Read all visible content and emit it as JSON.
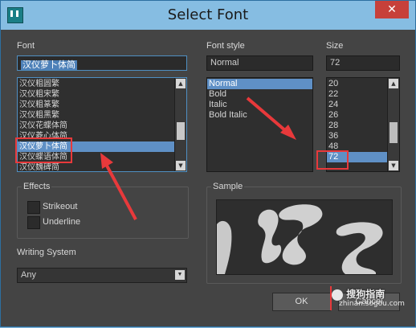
{
  "window": {
    "title": "Select Font",
    "close_glyph": "✕"
  },
  "font": {
    "label": "Font",
    "value": "汉仪萝卜体简",
    "items": [
      "汉仪粗圆繁",
      "汉仪粗宋繁",
      "汉仪粗篆繁",
      "汉仪粗黑繁",
      "汉仪花蝶体简",
      "汉仪菱心体简",
      "汉仪萝卜体简",
      "汉仪蝶语体简",
      "汉仪魏碑简"
    ],
    "selected_index": 6
  },
  "font_style": {
    "label": "Font style",
    "value": "Normal",
    "items": [
      "Normal",
      "Bold",
      "Italic",
      "Bold Italic"
    ],
    "selected_index": 0
  },
  "size": {
    "label": "Size",
    "value": "72",
    "items": [
      "20",
      "22",
      "24",
      "26",
      "28",
      "36",
      "48",
      "72"
    ],
    "selected_index": 7
  },
  "effects": {
    "label": "Effects",
    "strikeout": "Strikeout",
    "underline": "Underline"
  },
  "sample": {
    "label": "Sample"
  },
  "writing_system": {
    "label": "Writing System",
    "value": "Any"
  },
  "buttons": {
    "ok": "OK",
    "cancel": "Cancel"
  },
  "watermark": {
    "line1": "搜狗指南",
    "line2": "zhinan.sogou.com"
  },
  "annotation_color": "#e8393b"
}
